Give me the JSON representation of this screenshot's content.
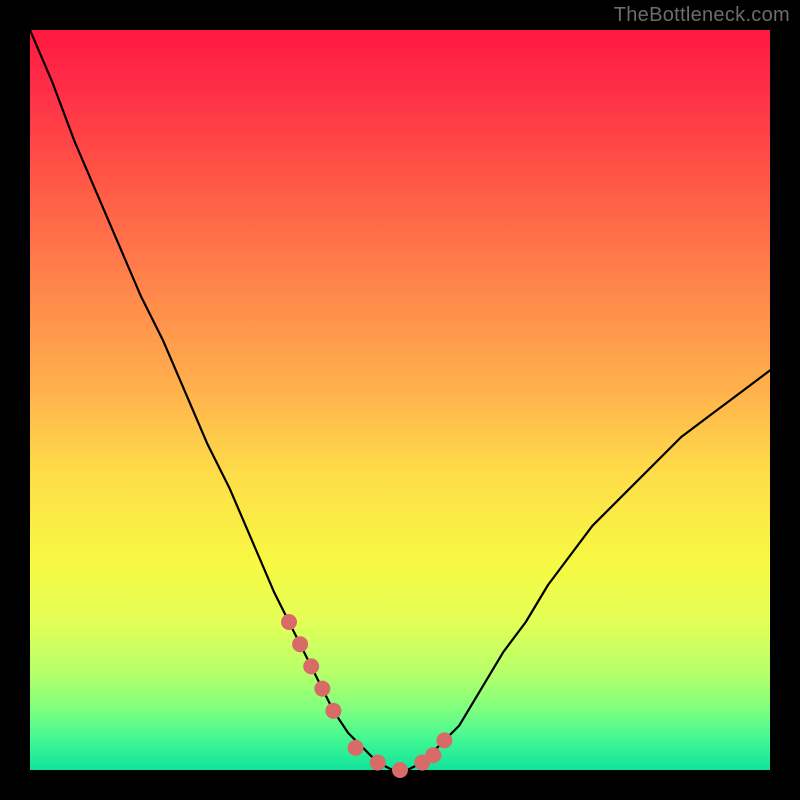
{
  "watermark": "TheBottleneck.com",
  "chart_data": {
    "type": "line",
    "title": "",
    "xlabel": "",
    "ylabel": "",
    "xlim": [
      0,
      100
    ],
    "ylim": [
      0,
      100
    ],
    "series": [
      {
        "name": "bottleneck-curve",
        "x": [
          0,
          3,
          6,
          9,
          12,
          15,
          18,
          21,
          24,
          27,
          30,
          33,
          35,
          37,
          39,
          41,
          43,
          45,
          47,
          49,
          51,
          53,
          55,
          58,
          61,
          64,
          67,
          70,
          73,
          76,
          80,
          84,
          88,
          92,
          96,
          100
        ],
        "values": [
          100,
          93,
          85,
          78,
          71,
          64,
          58,
          51,
          44,
          38,
          31,
          24,
          20,
          16,
          12,
          8,
          5,
          3,
          1,
          0,
          0,
          1,
          3,
          6,
          11,
          16,
          20,
          25,
          29,
          33,
          37,
          41,
          45,
          48,
          51,
          54
        ]
      }
    ],
    "markers": {
      "name": "highlight-dots",
      "color": "#d86b68",
      "x": [
        35,
        36.5,
        38,
        39.5,
        41,
        44,
        47,
        50,
        53,
        54.5,
        56
      ],
      "values": [
        20,
        17,
        14,
        11,
        8,
        3,
        1,
        0,
        1,
        2,
        4
      ]
    },
    "plot_background": "rainbow-vertical",
    "frame_color": "#000000"
  }
}
